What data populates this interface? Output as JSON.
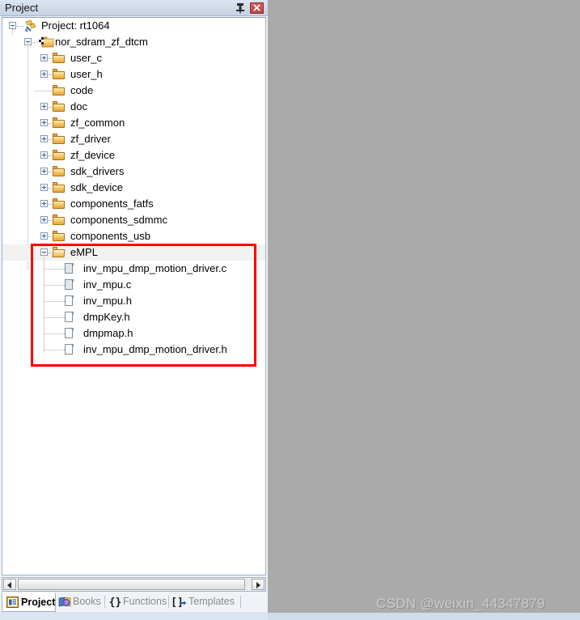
{
  "panel": {
    "title": "Project",
    "pin_icon": "pin-icon",
    "close_icon": "close-icon",
    "close_label": "x"
  },
  "tree": {
    "root": {
      "label": "Project: rt1064",
      "icon": "project-icon",
      "expanded": true
    },
    "target": {
      "label": "nor_sdram_zf_dtcm",
      "icon": "target-folder-icon",
      "expanded": true
    },
    "groups": [
      {
        "label": "user_c",
        "expanded": false,
        "icon": "folder-icon"
      },
      {
        "label": "user_h",
        "expanded": false,
        "icon": "folder-icon"
      },
      {
        "label": "code",
        "expanded": null,
        "icon": "folder-icon"
      },
      {
        "label": "doc",
        "expanded": false,
        "icon": "folder-icon"
      },
      {
        "label": "zf_common",
        "expanded": false,
        "icon": "folder-icon"
      },
      {
        "label": "zf_driver",
        "expanded": false,
        "icon": "folder-icon"
      },
      {
        "label": "zf_device",
        "expanded": false,
        "icon": "folder-icon"
      },
      {
        "label": "sdk_drivers",
        "expanded": false,
        "icon": "folder-icon"
      },
      {
        "label": "sdk_device",
        "expanded": false,
        "icon": "folder-icon"
      },
      {
        "label": "components_fatfs",
        "expanded": false,
        "icon": "folder-icon"
      },
      {
        "label": "components_sdmmc",
        "expanded": false,
        "icon": "folder-icon"
      },
      {
        "label": "components_usb",
        "expanded": false,
        "icon": "folder-icon"
      }
    ],
    "selected_group": {
      "label": "eMPL",
      "expanded": true,
      "icon": "folder-open-icon"
    },
    "files": [
      {
        "label": "inv_mpu_dmp_motion_driver.c",
        "kind": "source",
        "icon": "source-file-icon"
      },
      {
        "label": "inv_mpu.c",
        "kind": "source",
        "icon": "source-file-icon"
      },
      {
        "label": "inv_mpu.h",
        "kind": "header",
        "icon": "header-file-icon"
      },
      {
        "label": "dmpKey.h",
        "kind": "header",
        "icon": "header-file-icon"
      },
      {
        "label": "dmpmap.h",
        "kind": "header",
        "icon": "header-file-icon"
      },
      {
        "label": "inv_mpu_dmp_motion_driver.h",
        "kind": "header",
        "icon": "header-file-icon"
      }
    ]
  },
  "annotation": {
    "color": "#ff0000",
    "shape": "rectangle",
    "highlights": "eMPL group and its six source files"
  },
  "scrollbar": {
    "left_arrow_icon": "arrow-left-icon",
    "right_arrow_icon": "arrow-right-icon",
    "orientation": "horizontal"
  },
  "tabs": [
    {
      "label": "Project",
      "icon": "project-tab-icon",
      "active": true
    },
    {
      "label": "Books",
      "icon": "books-icon",
      "active": false
    },
    {
      "label": "Functions",
      "icon": "braces-icon",
      "active": false
    },
    {
      "label": "Templates",
      "icon": "templates-icon",
      "active": false
    }
  ],
  "watermark": {
    "text": "CSDN @weixin_44347879"
  },
  "colors": {
    "accent": "#2a5fa5",
    "annotation": "#ff0000",
    "folder": "#e8a434",
    "desktop": "#aaaaaa",
    "titlebar": "#cfdbe8"
  }
}
